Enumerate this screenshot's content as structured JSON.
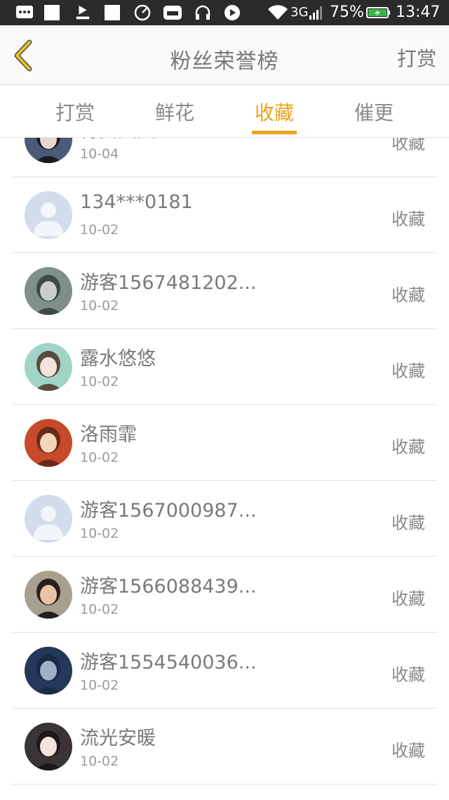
{
  "status_bar": {
    "network": "3G",
    "battery": "75%",
    "time": "13:47",
    "icons": [
      "message-icon",
      "youku-icon",
      "square-icon",
      "speed-icon",
      "app-store-icon",
      "headset-icon",
      "play-icon",
      "wifi-icon",
      "signal-icon",
      "battery-icon"
    ]
  },
  "header": {
    "title": "粉丝荣誉榜",
    "right_action": "打赏",
    "accent_color": "#f0a11a"
  },
  "tabs": [
    {
      "label": "打赏",
      "active": false
    },
    {
      "label": "鲜花",
      "active": false
    },
    {
      "label": "收藏",
      "active": true
    },
    {
      "label": "催更",
      "active": false
    }
  ],
  "list": [
    {
      "name": "肖贝大大",
      "date": "10-04",
      "action": "收藏",
      "avatar": "photo-dark-hair"
    },
    {
      "name": "134***0181",
      "date": "10-02",
      "action": "收藏",
      "avatar": "default"
    },
    {
      "name": "游客1567481202...",
      "date": "10-02",
      "action": "收藏",
      "avatar": "photo-girl-grey"
    },
    {
      "name": "露水悠悠",
      "date": "10-02",
      "action": "收藏",
      "avatar": "photo-girl-teal"
    },
    {
      "name": "洛雨霏",
      "date": "10-02",
      "action": "收藏",
      "avatar": "illustration-red"
    },
    {
      "name": "游客1567000987...",
      "date": "10-02",
      "action": "收藏",
      "avatar": "default"
    },
    {
      "name": "游客1566088439...",
      "date": "10-02",
      "action": "收藏",
      "avatar": "photo-woman"
    },
    {
      "name": "游客1554540036...",
      "date": "10-02",
      "action": "收藏",
      "avatar": "illustration-dark-blue"
    },
    {
      "name": "流光安暖",
      "date": "10-02",
      "action": "收藏",
      "avatar": "photo-girl-dark"
    }
  ]
}
